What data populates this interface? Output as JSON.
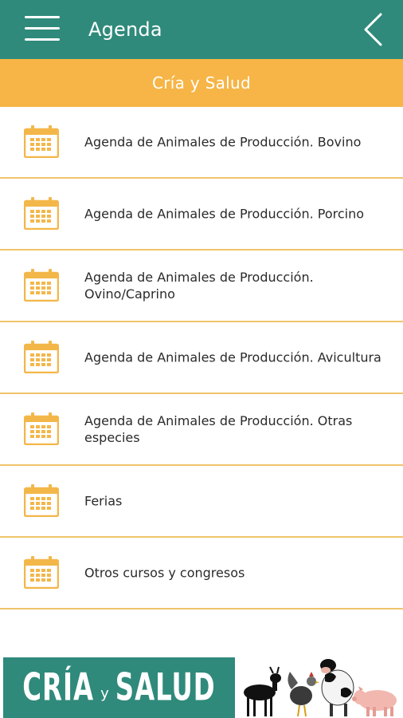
{
  "header": {
    "title": "Agenda",
    "menu_icon": "hamburger-menu-icon",
    "back_icon": "chevron-left-icon"
  },
  "section": {
    "title": "Cría y Salud"
  },
  "list": {
    "items": [
      {
        "label": "Agenda de Animales de Producción. Bovino",
        "icon": "calendar-icon"
      },
      {
        "label": "Agenda de Animales de Producción. Porcino",
        "icon": "calendar-icon"
      },
      {
        "label": "Agenda de Animales de Producción. Ovino/Caprino",
        "icon": "calendar-icon"
      },
      {
        "label": "Agenda de Animales de Producción. Avicultura",
        "icon": "calendar-icon"
      },
      {
        "label": "Agenda de Animales de Producción. Otras especies",
        "icon": "calendar-icon"
      },
      {
        "label": "Ferias",
        "icon": "calendar-icon"
      },
      {
        "label": "Otros cursos y congresos",
        "icon": "calendar-icon"
      }
    ]
  },
  "banner": {
    "word1": "CRÍA",
    "word2": "y",
    "word3": "SALUD"
  },
  "colors": {
    "header_bg": "#2f8a7b",
    "section_bg": "#f6b546",
    "divider": "#f0c46a",
    "icon": "#f3b749"
  }
}
